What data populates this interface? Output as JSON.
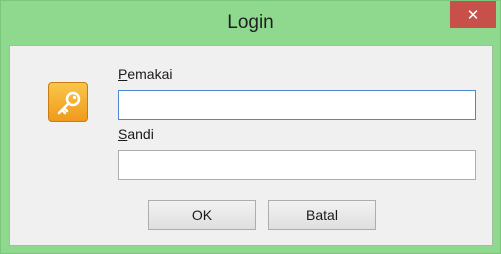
{
  "window": {
    "title": "Login",
    "close_glyph": "✕"
  },
  "form": {
    "user_label_hotkey": "P",
    "user_label_rest": "emakai",
    "user_value": "",
    "password_label_hotkey": "S",
    "password_label_rest": "andi",
    "password_value": ""
  },
  "buttons": {
    "ok_label": "OK",
    "cancel_label": "Batal"
  },
  "icons": {
    "login_icon": "key-icon"
  },
  "colors": {
    "titlebar_bg": "#8fd98e",
    "close_bg": "#c7504b",
    "key_icon": "#f4b030"
  }
}
